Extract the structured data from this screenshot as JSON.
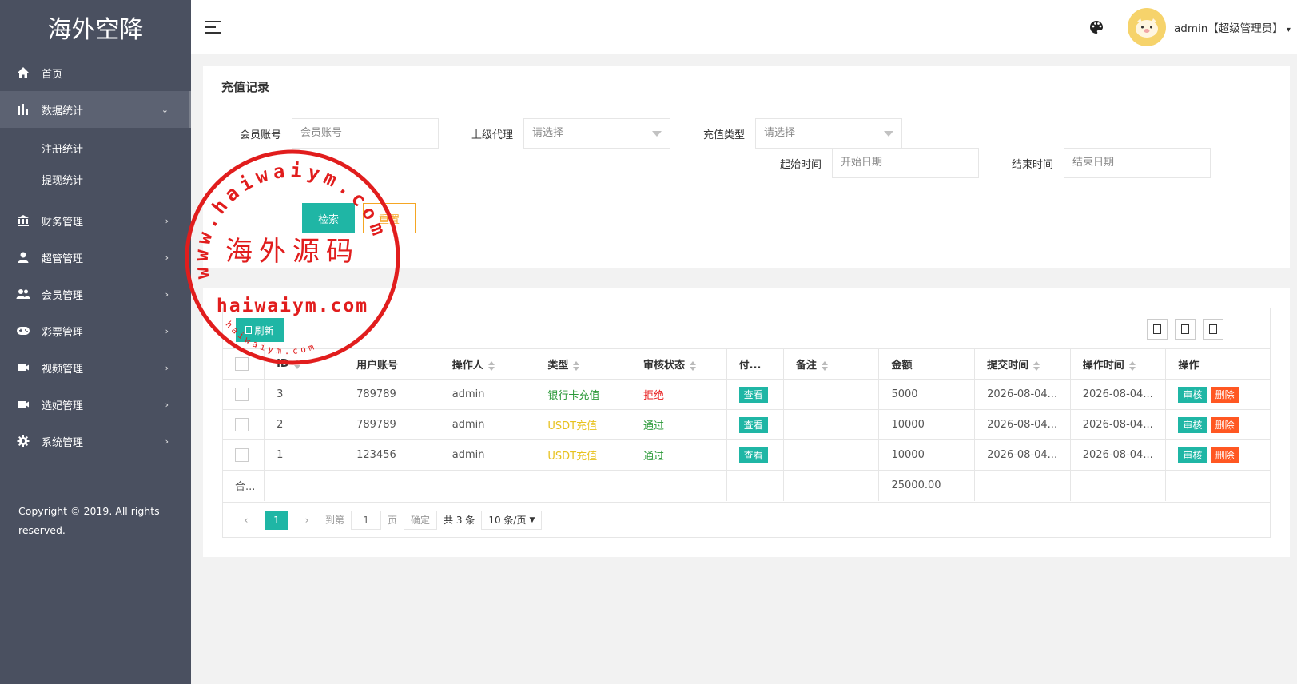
{
  "app": {
    "title": "海外空降"
  },
  "sidebar": {
    "items": [
      {
        "label": "首页",
        "icon": "home-icon"
      },
      {
        "label": "数据统计",
        "icon": "bar-chart-icon",
        "arrow": "⌄"
      },
      {
        "label": "注册统计"
      },
      {
        "label": "提现统计"
      },
      {
        "label": "财务管理",
        "icon": "bank-icon",
        "arrow": "›"
      },
      {
        "label": "超管管理",
        "icon": "user-icon",
        "arrow": "›"
      },
      {
        "label": "会员管理",
        "icon": "users-icon",
        "arrow": "›"
      },
      {
        "label": "彩票管理",
        "icon": "gamepad-icon",
        "arrow": "›"
      },
      {
        "label": "视频管理",
        "icon": "video-icon",
        "arrow": "›"
      },
      {
        "label": "选妃管理",
        "icon": "video-icon",
        "arrow": "›"
      },
      {
        "label": "系统管理",
        "icon": "gear-icon",
        "arrow": "›"
      }
    ],
    "copyright": "Copyright © 2019. All rights reserved."
  },
  "header": {
    "user": "admin【超级管理员】",
    "caret": "▾"
  },
  "panel": {
    "title": "充值记录"
  },
  "filters": {
    "member_label": "会员账号",
    "member_placeholder": "会员账号",
    "agent_label": "上级代理",
    "agent_value": "请选择",
    "type_label": "充值类型",
    "type_value": "请选择",
    "start_label": "起始时间",
    "start_placeholder": "开始日期",
    "end_label": "结束时间",
    "end_placeholder": "结束日期",
    "search_label": "检索",
    "reset_label": "重置"
  },
  "toolbar": {
    "refresh_label": "刷新"
  },
  "table": {
    "headers": [
      "ID",
      "用户账号",
      "操作人",
      "类型",
      "审核状态",
      "付...",
      "备注",
      "金额",
      "提交时间",
      "操作时间",
      "操作"
    ],
    "rows": [
      {
        "id": "3",
        "account": "789789",
        "operator": "admin",
        "type": "银行卡充值",
        "type_color": "#2b9939",
        "status": "拒绝",
        "status_color": "#e82020",
        "view": "查看",
        "note": "",
        "amount": "5000",
        "submit": "2026-08-04...",
        "op_time": "2026-08-04...",
        "audit": "审核",
        "delete": "删除"
      },
      {
        "id": "2",
        "account": "789789",
        "operator": "admin",
        "type": "USDT充值",
        "type_color": "#e8c21f",
        "status": "通过",
        "status_color": "#2b9939",
        "view": "查看",
        "note": "",
        "amount": "10000",
        "submit": "2026-08-04...",
        "op_time": "2026-08-04...",
        "audit": "审核",
        "delete": "删除"
      },
      {
        "id": "1",
        "account": "123456",
        "operator": "admin",
        "type": "USDT充值",
        "type_color": "#e8c21f",
        "status": "通过",
        "status_color": "#2b9939",
        "view": "查看",
        "note": "",
        "amount": "10000",
        "submit": "2026-08-04...",
        "op_time": "2026-08-04...",
        "audit": "审核",
        "delete": "删除"
      }
    ],
    "total_label": "合...",
    "total_amount": "25000.00"
  },
  "pager": {
    "current": "1",
    "goto_label": "到第",
    "goto_value": "1",
    "page_label": "页",
    "confirm": "确定",
    "total": "共 3 条",
    "per_page": "10 条/页"
  },
  "watermark": {
    "top_arc": "www.haiwaiym.com",
    "center": "海外源码",
    "bottom": "haiwaiym.com",
    "small_arc": "haiwaiym.com"
  },
  "colors": {
    "sidebar_bg": "#4a5060",
    "accent": "#1fb6a5",
    "danger": "#ff5722",
    "warning": "#f5a623",
    "stamp": "#e11d1d"
  }
}
